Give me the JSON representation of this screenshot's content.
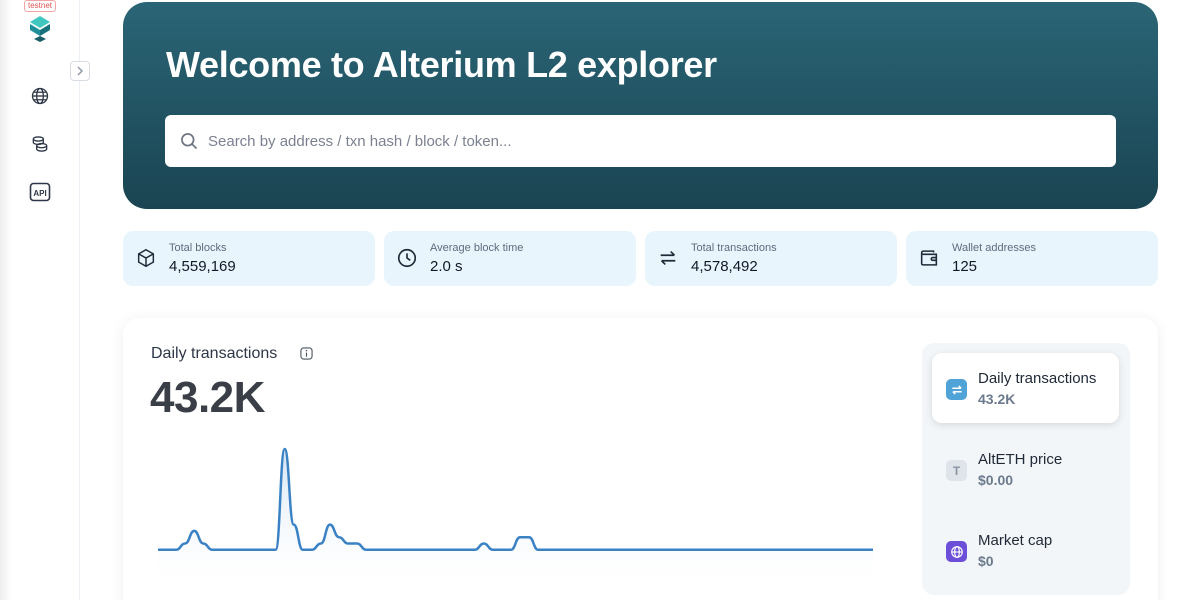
{
  "app": {
    "badge": "testnet",
    "logo_icon": "alterium-logo-icon"
  },
  "sidebar": {
    "items": [
      {
        "icon": "globe-icon",
        "label": "Blockchain"
      },
      {
        "icon": "coins-icon",
        "label": "Tokens"
      },
      {
        "icon": "api-icon",
        "text": "API"
      }
    ],
    "collapse_icon": "chevron-right-icon"
  },
  "hero": {
    "title": "Welcome to Alterium L2 explorer",
    "search": {
      "placeholder": "Search by address / txn hash / block / token...",
      "value": ""
    },
    "colors": {
      "gradient_top": "#2a6576",
      "gradient_bottom": "#1a4452"
    }
  },
  "stats": [
    {
      "icon": "cube-icon",
      "label": "Total blocks",
      "value": "4,559,169"
    },
    {
      "icon": "clock-icon",
      "label": "Average block time",
      "value": "2.0 s"
    },
    {
      "icon": "transfer-arrows-icon",
      "label": "Total transactions",
      "value": "4,578,492"
    },
    {
      "icon": "wallet-icon",
      "label": "Wallet addresses",
      "value": "125"
    }
  ],
  "chart_card": {
    "title": "Daily transactions",
    "info_icon": "info-icon",
    "value": "43.2K",
    "metrics": [
      {
        "label": "Daily transactions",
        "value": "43.2K",
        "icon": "transfer-arrows-icon",
        "active": true,
        "color": "#4fa3d6"
      },
      {
        "label": "AltETH price",
        "value": "$0.00",
        "icon": "token-t-icon",
        "active": false,
        "color": "#dfe4ea",
        "glyph": "T"
      },
      {
        "label": "Market cap",
        "value": "$0",
        "icon": "globe-icon",
        "active": false,
        "color": "#6b4fd8"
      }
    ]
  },
  "chart_data": {
    "type": "area",
    "series": [
      {
        "values": [
          4,
          4,
          4,
          5,
          7,
          5,
          4,
          4,
          4,
          4,
          4,
          4,
          4,
          4,
          20,
          8,
          4,
          4,
          5,
          8,
          6,
          5,
          5,
          4,
          4,
          4,
          4,
          4,
          4,
          4,
          4,
          4,
          4,
          4,
          4,
          4,
          5,
          4,
          4,
          4,
          6,
          6,
          4,
          4,
          4,
          4,
          4,
          4,
          4,
          4,
          4,
          4,
          4,
          4,
          4,
          4,
          4,
          4,
          4,
          4,
          4,
          4,
          4,
          4,
          4,
          4,
          4,
          4,
          4,
          4,
          4,
          4,
          4,
          4,
          4,
          4,
          4,
          4,
          4,
          4
        ]
      }
    ],
    "colors": {
      "line": "#3b82c4",
      "fill_top": "#cfe2f3",
      "fill_bottom": "#ffffff"
    }
  }
}
